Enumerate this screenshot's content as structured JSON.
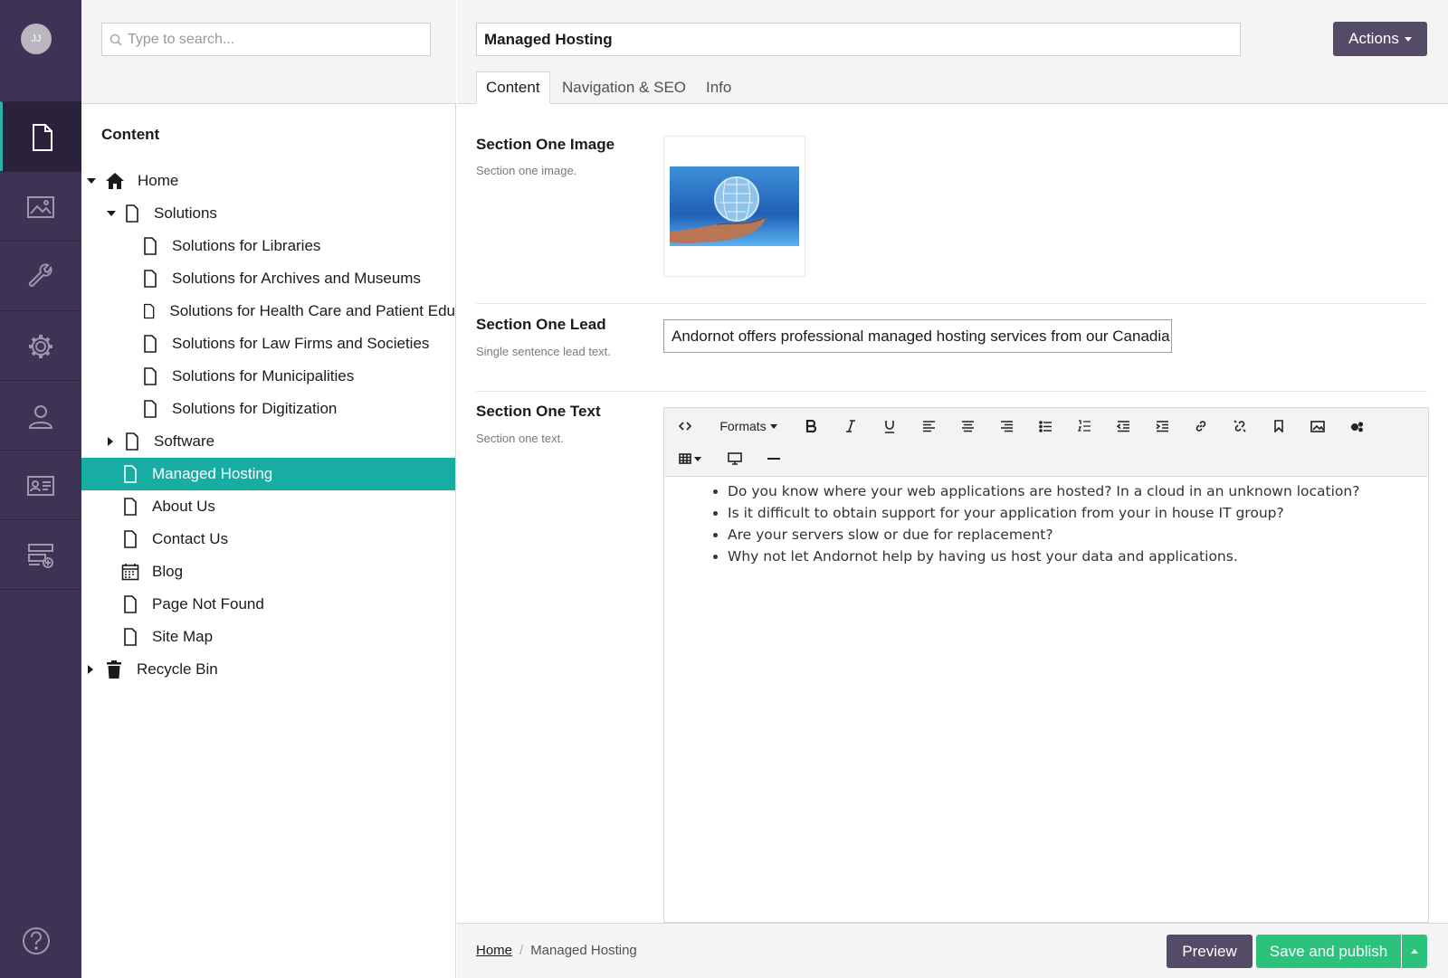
{
  "user": {
    "initials": "JJ"
  },
  "nav": {
    "items": [
      {
        "name": "content",
        "icon": "document-icon",
        "active": true
      },
      {
        "name": "media",
        "icon": "image-icon",
        "active": false
      },
      {
        "name": "settings",
        "icon": "wrench-icon",
        "active": false
      },
      {
        "name": "developer",
        "icon": "gear-icon",
        "active": false
      },
      {
        "name": "users",
        "icon": "user-icon",
        "active": false
      },
      {
        "name": "members",
        "icon": "id-card-icon",
        "active": false
      },
      {
        "name": "forms",
        "icon": "form-add-icon",
        "active": false
      }
    ],
    "help_icon": "help-icon"
  },
  "tree": {
    "search_placeholder": "Type to search...",
    "title": "Content",
    "items": [
      {
        "label": "Home",
        "icon": "home-icon"
      },
      {
        "label": "Solutions",
        "icon": "document-icon"
      },
      {
        "label": "Solutions for Libraries",
        "icon": "document-icon"
      },
      {
        "label": "Solutions for Archives and Museums",
        "icon": "document-icon"
      },
      {
        "label": "Solutions for Health Care and Patient Edu",
        "icon": "document-icon"
      },
      {
        "label": "Solutions for Law Firms and Societies",
        "icon": "document-icon"
      },
      {
        "label": "Solutions for Municipalities",
        "icon": "document-icon"
      },
      {
        "label": "Solutions for Digitization",
        "icon": "document-icon"
      },
      {
        "label": "Software",
        "icon": "document-icon"
      },
      {
        "label": "Managed Hosting",
        "icon": "document-icon",
        "selected": true
      },
      {
        "label": "About Us",
        "icon": "document-icon"
      },
      {
        "label": "Contact Us",
        "icon": "document-icon"
      },
      {
        "label": "Blog",
        "icon": "calendar-icon"
      },
      {
        "label": "Page Not Found",
        "icon": "document-icon"
      },
      {
        "label": "Site Map",
        "icon": "document-icon"
      },
      {
        "label": "Recycle Bin",
        "icon": "trash-icon"
      }
    ]
  },
  "editor": {
    "name_value": "Managed Hosting",
    "actions_label": "Actions",
    "tabs": [
      {
        "label": "Content",
        "active": true
      },
      {
        "label": "Navigation & SEO",
        "active": false
      },
      {
        "label": "Info",
        "active": false
      }
    ],
    "properties": {
      "image": {
        "label": "Section One Image",
        "description": "Section one image."
      },
      "lead": {
        "label": "Section One Lead",
        "description": "Single sentence lead text.",
        "value": "Andornot offers professional managed hosting services from our Canadia"
      },
      "text": {
        "label": "Section One Text",
        "description": "Section one text.",
        "toolbar": {
          "formats_label": "Formats"
        },
        "bullets": [
          "Do you know where your web applications are hosted? In a cloud in an unknown location?",
          "Is it difficult to obtain support for your application from your in house IT group?",
          "Are your servers slow or due for replacement?",
          "Why not let Andornot help by having us host your data and applications."
        ]
      }
    }
  },
  "footer": {
    "breadcrumb_home": "Home",
    "breadcrumb_separator": "/",
    "breadcrumb_current": "Managed Hosting",
    "preview_label": "Preview",
    "publish_label": "Save and publish"
  },
  "colors": {
    "nav_bg": "#3e3354",
    "accent_teal": "#17ada3",
    "button_purple": "#544b67",
    "publish_green": "#2bc37c"
  }
}
